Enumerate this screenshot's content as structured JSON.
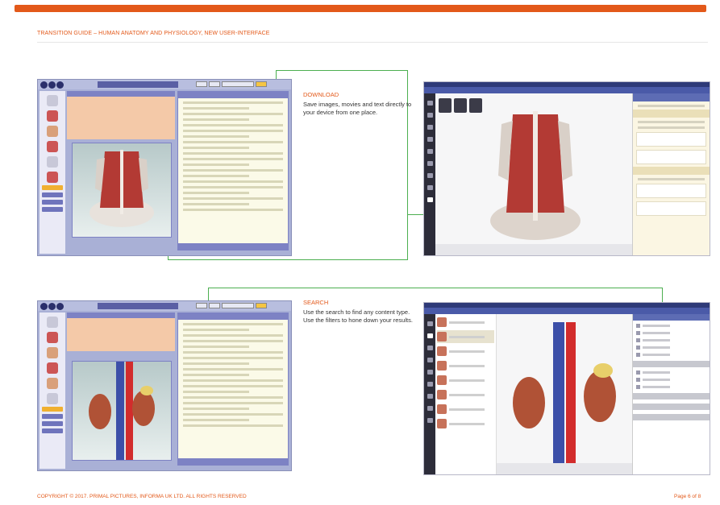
{
  "header": {
    "title": "TRANSITION GUIDE – HUMAN ANATOMY AND PHYSIOLOGY, NEW USER-INTERFACE",
    "accent_color": "#e3591a",
    "connector_color": "#4caf50"
  },
  "download": {
    "title": "DOWNLOAD",
    "body": "Save images, movies and text directly to your device from one place."
  },
  "search": {
    "title": "SEARCH",
    "body": "Use the search to find any content type. Use the filters to hone down your results."
  },
  "footer": {
    "copyright": "COPYRIGHT © 2017. PRIMAL PICTURES, INFORMA UK LTD. ALL RIGHTS RESERVED",
    "page": "Page 6 of  8"
  }
}
